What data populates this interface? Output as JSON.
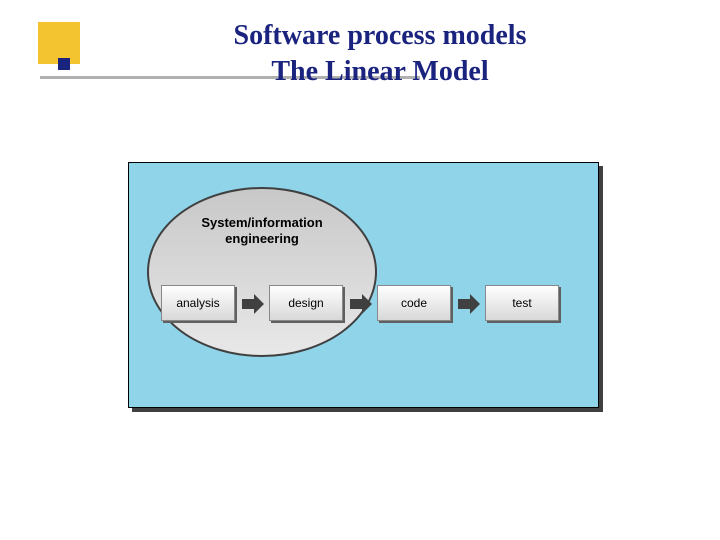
{
  "title_line1": "Software process models",
  "title_line2": "The Linear Model",
  "diagram": {
    "ellipse_label_line1": "System/information",
    "ellipse_label_line2": "engineering",
    "steps": [
      "analysis",
      "design",
      "code",
      "test"
    ]
  },
  "colors": {
    "title": "#1a237e",
    "accent_yellow": "#f4c430",
    "diagram_bg": "#8fd4e8"
  }
}
